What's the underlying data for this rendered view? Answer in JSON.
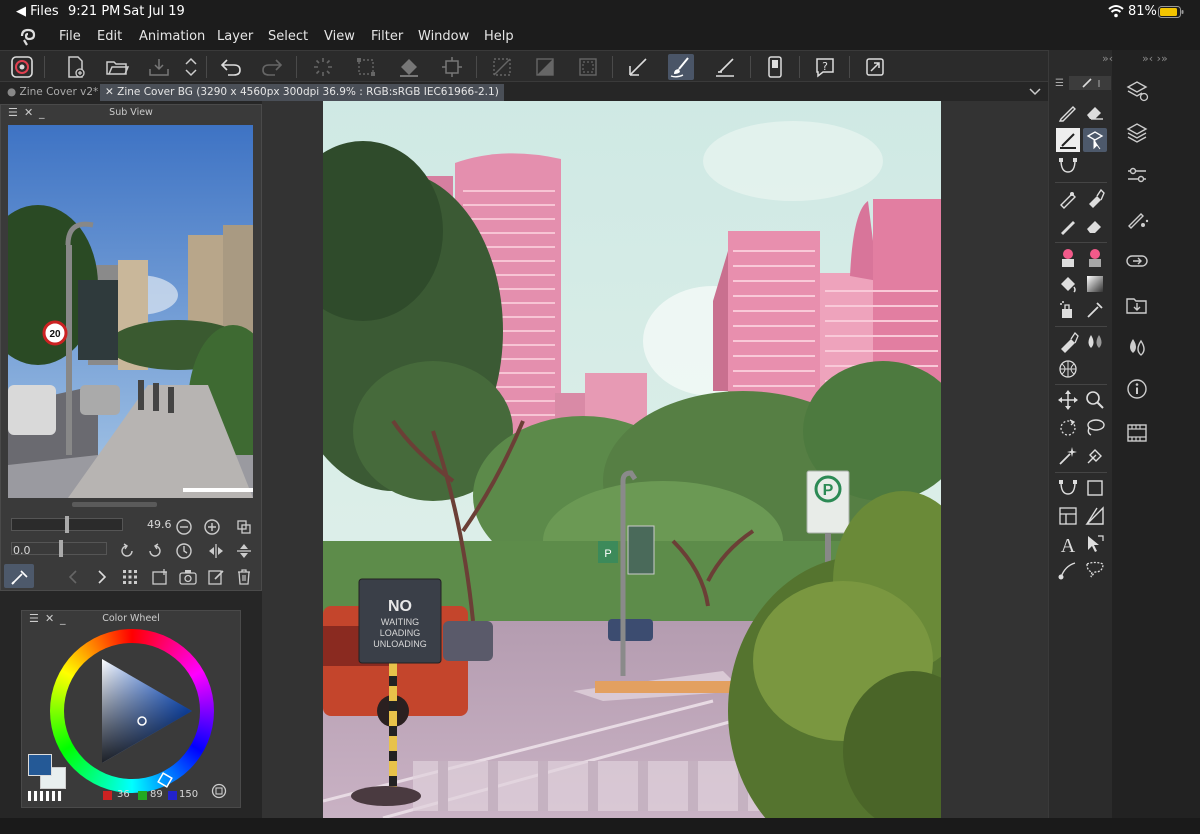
{
  "status_bar": {
    "back": "◀ Files",
    "time": "9:21 PM",
    "date": "Sat Jul 19",
    "battery": "81%"
  },
  "menu": [
    "File",
    "Edit",
    "Animation",
    "Layer",
    "Select",
    "View",
    "Filter",
    "Window",
    "Help"
  ],
  "tabs": [
    {
      "label": "Zine Cover v2*",
      "active": false
    },
    {
      "label": "Zine Cover BG (3290 x 4560px 300dpi 36.9% : RGB:sRGB IEC61966-2.1)",
      "active": true
    }
  ],
  "sub_view": {
    "title": "Sub View",
    "zoom": "49.6",
    "rotation": "0.0"
  },
  "color_wheel": {
    "title": "Color Wheel",
    "r": "36",
    "g": "89",
    "b": "150",
    "main_color": "#245996",
    "sub_color": "#e8efef"
  },
  "canvas": {
    "sign_no": "NO",
    "sign_lines": [
      "WAITING",
      "LOADING",
      "UNLOADING"
    ],
    "parking_letter": "P"
  },
  "photo": {
    "speed_limit": "20"
  },
  "icons": {
    "toolbar": [
      "app-logo-icon",
      "new-file-icon",
      "open-file-icon",
      "save-icon",
      "expand-arrows-icon",
      "undo-icon",
      "redo-icon",
      "loading-icon",
      "transform-selection-icon",
      "fill-icon",
      "crop-icon",
      "clear-selection-icon",
      "invert-selection-icon",
      "show-selection-icon",
      "pen-pressure-icon",
      "brush-icon",
      "ruler-icon",
      "smartphone-icon",
      "help-icon",
      "fullscreen-icon"
    ],
    "far_right": [
      "layer-properties-icon",
      "layers-icon",
      "tool-property-icon",
      "brush-size-icon",
      "navigator-icon",
      "material-icon",
      "color-icon",
      "info-icon",
      "timeline-icon"
    ]
  }
}
